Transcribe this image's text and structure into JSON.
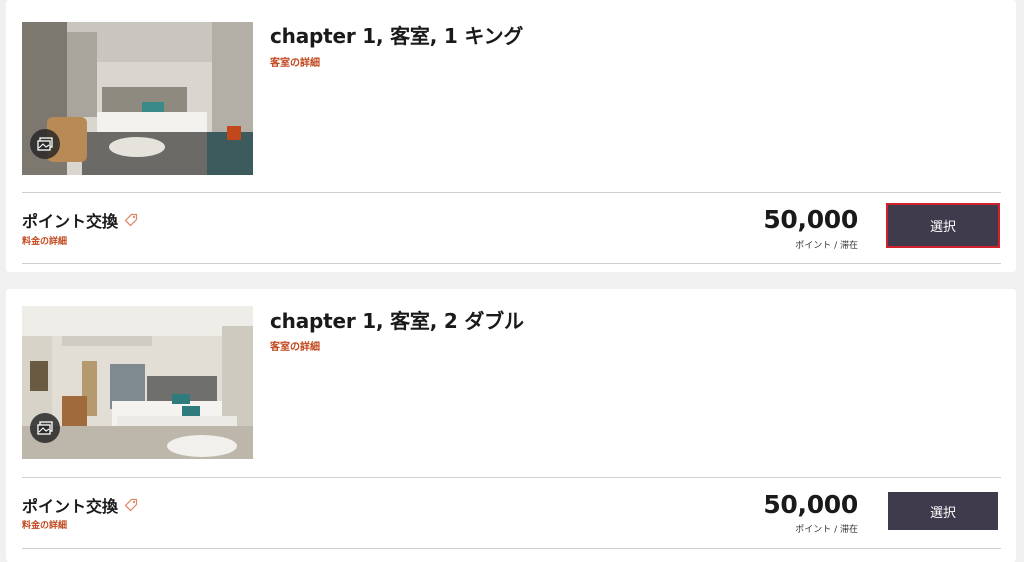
{
  "rooms": [
    {
      "title": "chapter 1, 客室, 1 キング",
      "details_link": "客室の詳細",
      "rate_name": "ポイント交換",
      "rate_details_link": "料金の詳細",
      "price": "50,000",
      "price_unit": "ポイント / 滞在",
      "select_label": "選択",
      "selected": true
    },
    {
      "title": "chapter 1, 客室, 2 ダブル",
      "details_link": "客室の詳細",
      "rate_name": "ポイント交換",
      "rate_details_link": "料金の詳細",
      "price": "50,000",
      "price_unit": "ポイント / 滞在",
      "select_label": "選択",
      "selected": false
    }
  ],
  "colors": {
    "accent_link": "#c2491f",
    "button_bg": "#3f3a4c",
    "focus_outline": "#d2212d"
  },
  "icons": {
    "gallery": "gallery-icon",
    "rate_tag": "tag-icon"
  }
}
